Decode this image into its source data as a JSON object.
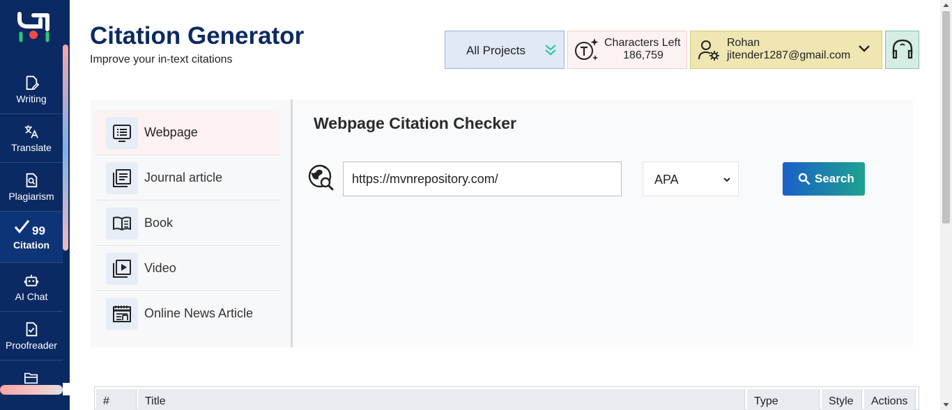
{
  "header": {
    "title": "Citation Generator",
    "subtitle": "Improve your in-text citations",
    "projects_label": "All Projects",
    "characters_left_label": "Characters Left",
    "characters_left_value": "186,759",
    "user_name": "Rohan",
    "user_email": "jitender1287@gmail.com"
  },
  "sidebar": {
    "items": [
      {
        "label": "Writing",
        "icon": "writing-icon"
      },
      {
        "label": "Translate",
        "icon": "translate-icon"
      },
      {
        "label": "Plagiarism",
        "icon": "plagiarism-icon"
      },
      {
        "label": "Citation",
        "icon": "citation-icon",
        "active": true
      },
      {
        "label": "AI Chat",
        "icon": "robot-icon"
      },
      {
        "label": "Proofreader",
        "icon": "proofreader-icon"
      },
      {
        "label": "",
        "icon": "folder-icon"
      }
    ]
  },
  "citation_types": [
    {
      "label": "Webpage",
      "icon": "webpage-icon",
      "active": true
    },
    {
      "label": "Journal article",
      "icon": "journal-icon"
    },
    {
      "label": "Book",
      "icon": "book-icon"
    },
    {
      "label": "Video",
      "icon": "video-icon"
    },
    {
      "label": "Online News Article",
      "icon": "news-icon"
    }
  ],
  "checker": {
    "title": "Webpage Citation Checker",
    "url_value": "https://mvnrepository.com/",
    "style_value": "APA",
    "search_label": "Search"
  },
  "table": {
    "columns": [
      "#",
      "Title",
      "Type",
      "Style",
      "Actions"
    ]
  },
  "colors": {
    "sidebar_bg": "#0b2a63",
    "title": "#0b2a63",
    "search_gradient_start": "#1a5fc9",
    "search_gradient_end": "#1ea38e"
  }
}
